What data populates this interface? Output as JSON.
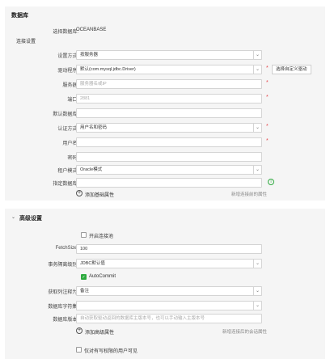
{
  "db_section": {
    "title": "数据库",
    "selected_label": "选择数据库:",
    "selected_value": "OCEANBASE",
    "conn_settings_title": "连接设置",
    "fields": {
      "connect_method": {
        "label": "设置方式:",
        "value": "按服务器"
      },
      "driver": {
        "label": "驱动程序:",
        "value": "默认(com.mysql.jdbc.Driver)",
        "button": "选择自定义驱动"
      },
      "server": {
        "label": "服务器:",
        "placeholder": "服务器名或IP"
      },
      "port": {
        "label": "端口:",
        "placeholder": "2881"
      },
      "default_db": {
        "label": "默认数据库:",
        "value": ""
      },
      "auth": {
        "label": "认证方式:",
        "value": "用户名和密码"
      },
      "username": {
        "label": "用户名:",
        "value": ""
      },
      "password": {
        "label": "密码:",
        "value": ""
      },
      "tenant_mode": {
        "label": "租户模式:",
        "value": "Oracle模式"
      },
      "specify_db": {
        "label": "指定数据库:",
        "value": ""
      }
    },
    "add_basic": {
      "label": "添加基础属性",
      "hint": "新增连接前的属性"
    }
  },
  "adv_section": {
    "title": "高级设置",
    "enable_pool": {
      "label": "开启连接池",
      "checked": false
    },
    "fetch_size": {
      "label": "FetchSize:",
      "value": "100"
    },
    "isolation": {
      "label": "事务隔离级别:",
      "value": "JDBC默认值"
    },
    "autocommit": {
      "label": "AutoCommit",
      "checked": true
    },
    "comment_as": {
      "label": "获取列注释为:",
      "value": "备注"
    },
    "charset": {
      "label": "数据库字符集:",
      "value": ""
    },
    "db_version": {
      "label": "数据库版本:",
      "placeholder": "自动获取驱动返回的数据库主版本号，也可以手动输入主版本号"
    },
    "add_advanced": {
      "label": "添加高级属性",
      "hint": "新增连接后的会话属性"
    },
    "visible_only_authorized": {
      "label": "仅对有写权限的用户可见",
      "checked": false
    }
  }
}
